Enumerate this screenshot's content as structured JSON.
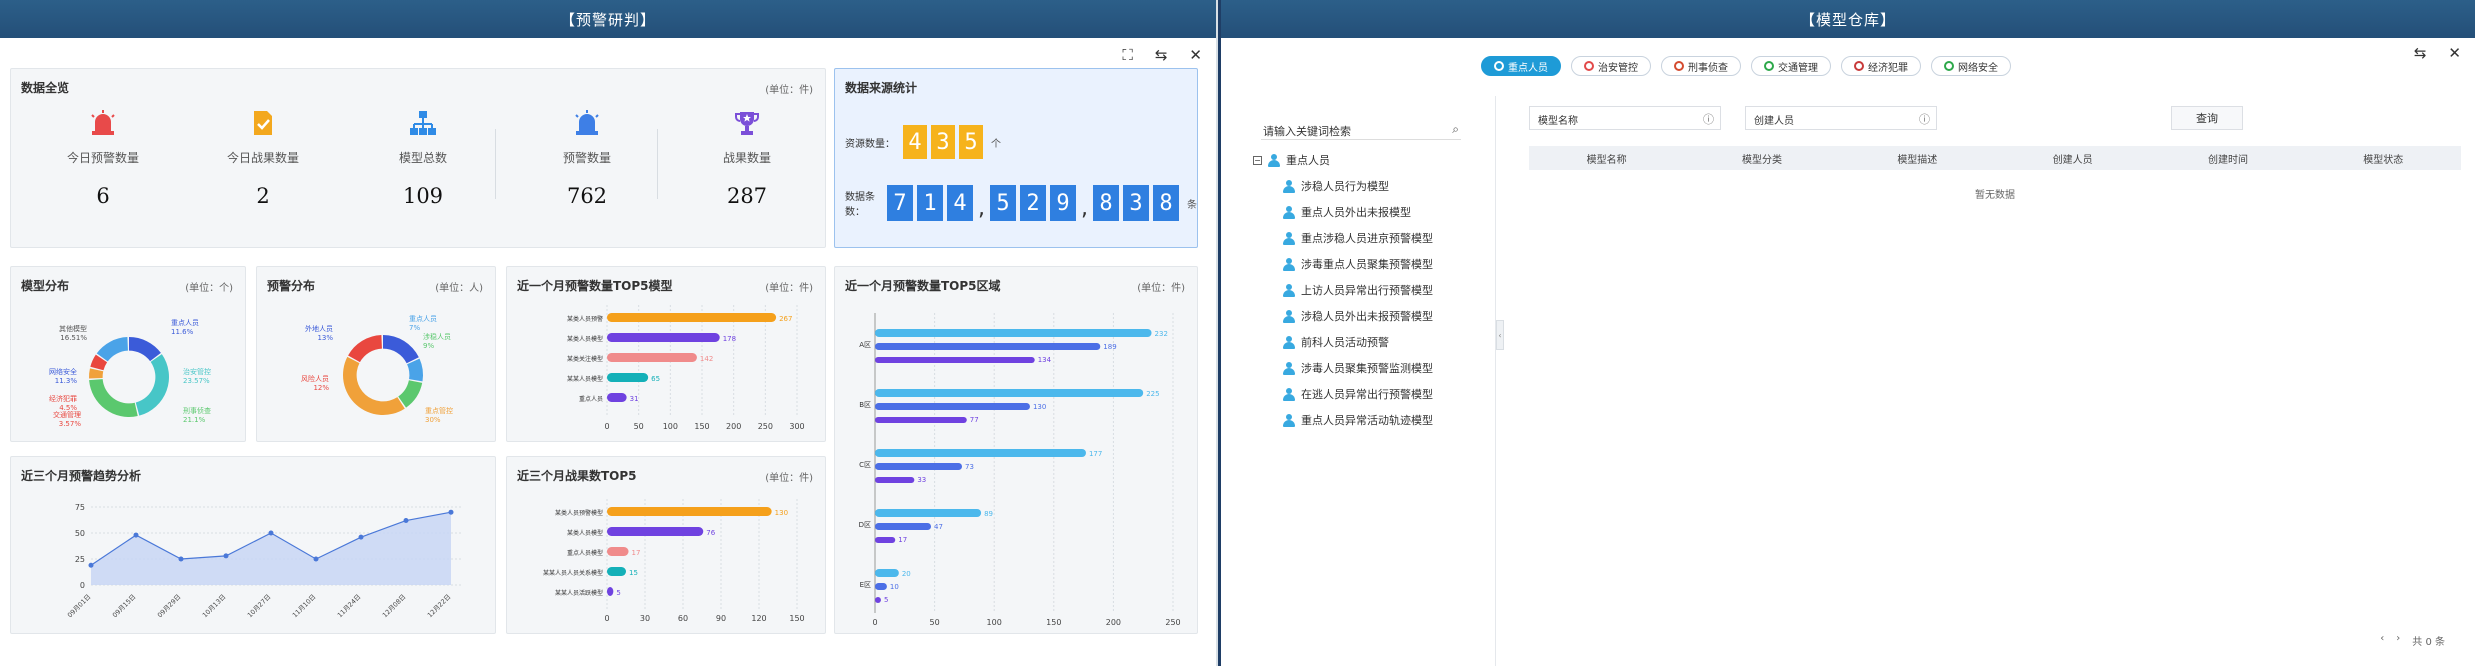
{
  "left": {
    "title": "【预警研判】",
    "tools": {
      "fullscreen": "⛶",
      "swap": "⇆",
      "close": "✕"
    },
    "overview": {
      "title": "数据全览",
      "unit": "(单位：件)",
      "stats": [
        {
          "label": "今日预警数量",
          "value": "6",
          "icon": "alarm-icon",
          "color": "#e84a4a"
        },
        {
          "label": "今日战果数量",
          "value": "2",
          "icon": "document-check-icon",
          "color": "#f3a81e"
        },
        {
          "label": "模型总数",
          "value": "109",
          "icon": "hierarchy-icon",
          "color": "#2f8be6"
        },
        {
          "label": "预警数量",
          "value": "762",
          "icon": "alarm-icon",
          "color": "#3e7fe6"
        },
        {
          "label": "战果数量",
          "value": "287",
          "icon": "trophy-icon",
          "color": "#7b4fd8"
        }
      ]
    },
    "source": {
      "title": "数据来源统计",
      "row1_label": "资源数量：",
      "row1_digits": [
        "4",
        "3",
        "5"
      ],
      "row1_unit": "个",
      "row2_label": "数据条数：",
      "row2_digits": [
        "7",
        "1",
        "4",
        ",",
        "5",
        "2",
        "9",
        ",",
        "8",
        "3",
        "8"
      ],
      "row2_unit": "条"
    },
    "model_dist": {
      "title": "模型分布",
      "unit": "(单位：个)"
    },
    "warn_dist": {
      "title": "预警分布",
      "unit": "(单位：人)"
    },
    "top5_models": {
      "title": "近一个月预警数量TOP5模型",
      "unit": "(单位：件)"
    },
    "top5_area": {
      "title": "近一个月预警数量TOP5区域",
      "unit": "(单位：件)"
    },
    "trend": {
      "title": "近三个月预警趋势分析"
    },
    "top5_results": {
      "title": "近三个月战果数TOP5",
      "unit": "(单位：件)"
    }
  },
  "chart_data": [
    {
      "type": "pie",
      "title": "模型分布",
      "labels": [
        "重点人员",
        "治安管控",
        "刑事侦查",
        "交通管理",
        "经济犯罪",
        "网络安全"
      ],
      "values": [
        11.6,
        23.57,
        21.1,
        3.57,
        4.5,
        11.3
      ],
      "colors": [
        "#3b5bd9",
        "#47c6c7",
        "#5bc86e",
        "#f0a13a",
        "#e9473f",
        "#4aa3e8"
      ],
      "printed_labels": [
        "重点人员\n11.6%",
        "治安管控\n23.57%",
        "刑事侦查\n21.1%",
        "交通管理\n3.57%",
        "经济犯罪\n4.5%",
        "网络安全\n11.3%",
        "其他模型\n16.51%"
      ]
    },
    {
      "type": "pie",
      "title": "预警分布",
      "labels": [
        "外地人员",
        "重点人员",
        "涉稳人员",
        "重点管控",
        "风险人员"
      ],
      "values": [
        13,
        7,
        9,
        30,
        12
      ],
      "colors": [
        "#3b5bd9",
        "#4aa3e8",
        "#5bc86e",
        "#f0a13a",
        "#e9473f"
      ],
      "printed_labels": [
        "外地人员\n13%",
        "重点人员\n7%",
        "涉稳人员\n9%",
        "重点管控\n30%",
        "风险人员\n12%"
      ]
    },
    {
      "type": "bar",
      "title": "近一个月预警数量TOP5模型",
      "categories": [
        "某类人员预警",
        "某类人员模型",
        "某类关注模型",
        "某某人员模型",
        "重点人员"
      ],
      "values": [
        267,
        178,
        142,
        65,
        31
      ],
      "colors": [
        "#f5a01b",
        "#6f42e0",
        "#f08b8b",
        "#14b0b8",
        "#6f42e0"
      ],
      "xlim": [
        0,
        300
      ],
      "ticks": [
        0,
        50,
        100,
        150,
        200,
        250,
        300
      ]
    },
    {
      "type": "bar",
      "title": "近一个月预警数量TOP5区域",
      "categories": [
        "A区",
        "B区",
        "C区",
        "D区",
        "E区"
      ],
      "series": [
        {
          "values": [
            232,
            225,
            177,
            89,
            20
          ]
        },
        {
          "values": [
            189,
            130,
            73,
            47,
            10
          ]
        },
        {
          "values": [
            134,
            77,
            33,
            17,
            5
          ]
        }
      ],
      "xlim": [
        0,
        250
      ],
      "ticks": [
        0,
        50,
        100,
        150,
        200,
        250
      ],
      "colors": [
        "#4cb8ec",
        "#4c6fe6",
        "#6f42e0"
      ]
    },
    {
      "type": "area",
      "title": "近三个月预警趋势分析",
      "x": [
        "09月01日",
        "09月15日",
        "09月29日",
        "10月13日",
        "10月27日",
        "11月10日",
        "11月24日",
        "12月08日",
        "12月22日"
      ],
      "values": [
        19,
        48,
        25,
        28,
        50,
        25,
        46,
        62,
        70
      ],
      "ylim": [
        0,
        75
      ],
      "ticks": [
        0,
        25,
        50,
        75
      ]
    },
    {
      "type": "bar",
      "title": "近三个月战果数TOP5",
      "categories": [
        "某类人员预警模型",
        "某类人员模型",
        "重点人员模型",
        "某某人员人员关系模型",
        "某某人员活跃模型"
      ],
      "values": [
        130,
        76,
        17,
        15,
        5
      ],
      "colors": [
        "#f5a01b",
        "#6f42e0",
        "#f08b8b",
        "#14b0b8",
        "#6f42e0"
      ],
      "xlim": [
        0,
        150
      ],
      "ticks": [
        0,
        30,
        60,
        90,
        120,
        150
      ]
    }
  ],
  "right": {
    "title": "【模型仓库】",
    "tools": {
      "swap": "⇆",
      "close": "✕"
    },
    "tabs": [
      {
        "label": "重点人员",
        "active": true,
        "color": "#ffffff"
      },
      {
        "label": "治安管控",
        "active": false,
        "color": "#e24949"
      },
      {
        "label": "刑事侦查",
        "active": false,
        "color": "#d44b2f"
      },
      {
        "label": "交通管理",
        "active": false,
        "color": "#2da84a"
      },
      {
        "label": "经济犯罪",
        "active": false,
        "color": "#c83a3a"
      },
      {
        "label": "网络安全",
        "active": false,
        "color": "#2da84a"
      }
    ],
    "tree": {
      "search_placeholder": "请输入关键词检索",
      "root": "重点人员",
      "items": [
        "涉稳人员行为模型",
        "重点人员外出未报模型",
        "重点涉稳人员进京预警模型",
        "涉毒重点人员聚集预警模型",
        "上访人员异常出行预警模型",
        "涉稳人员外出未报预警模型",
        "前科人员活动预警",
        "涉毒人员聚集预警监测模型",
        "在逃人员异常出行预警模型",
        "重点人员异常活动轨迹模型"
      ]
    },
    "filters": {
      "model_name_placeholder": "模型名称",
      "creator_placeholder": "创建人员",
      "query_label": "查询"
    },
    "table": {
      "columns": [
        "模型名称",
        "模型分类",
        "模型描述",
        "创建人员",
        "创建时间",
        "模型状态"
      ],
      "empty": "暂无数据"
    },
    "pager": {
      "prev": "‹",
      "next": "›",
      "total": "共 0 条"
    }
  }
}
